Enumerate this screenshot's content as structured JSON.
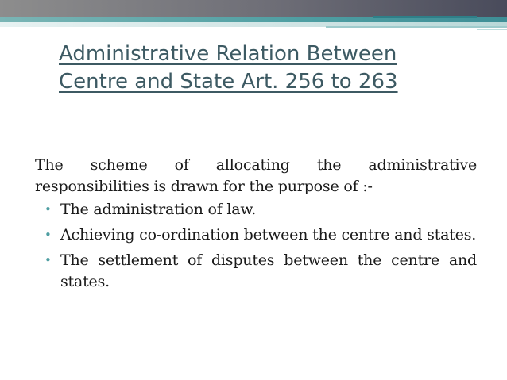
{
  "slide": {
    "title_line1": "Administrative Relation Between",
    "title_line2": "Centre and State Art. 256 to 263",
    "intro": "The scheme of allocating the administrative responsibilities is drawn for the purpose of :-",
    "bullets": [
      {
        "text": "The administration of law."
      },
      {
        "text": "Achieving co-ordination between the centre and states."
      },
      {
        "text": "The settlement of disputes between the centre and states."
      }
    ],
    "bullet_symbol": "•"
  },
  "colors": {
    "title": "#3d5a63",
    "accent_teal": "#4e9ea2",
    "header_dark": "#494b5b",
    "body_text": "#1a1a1a"
  }
}
